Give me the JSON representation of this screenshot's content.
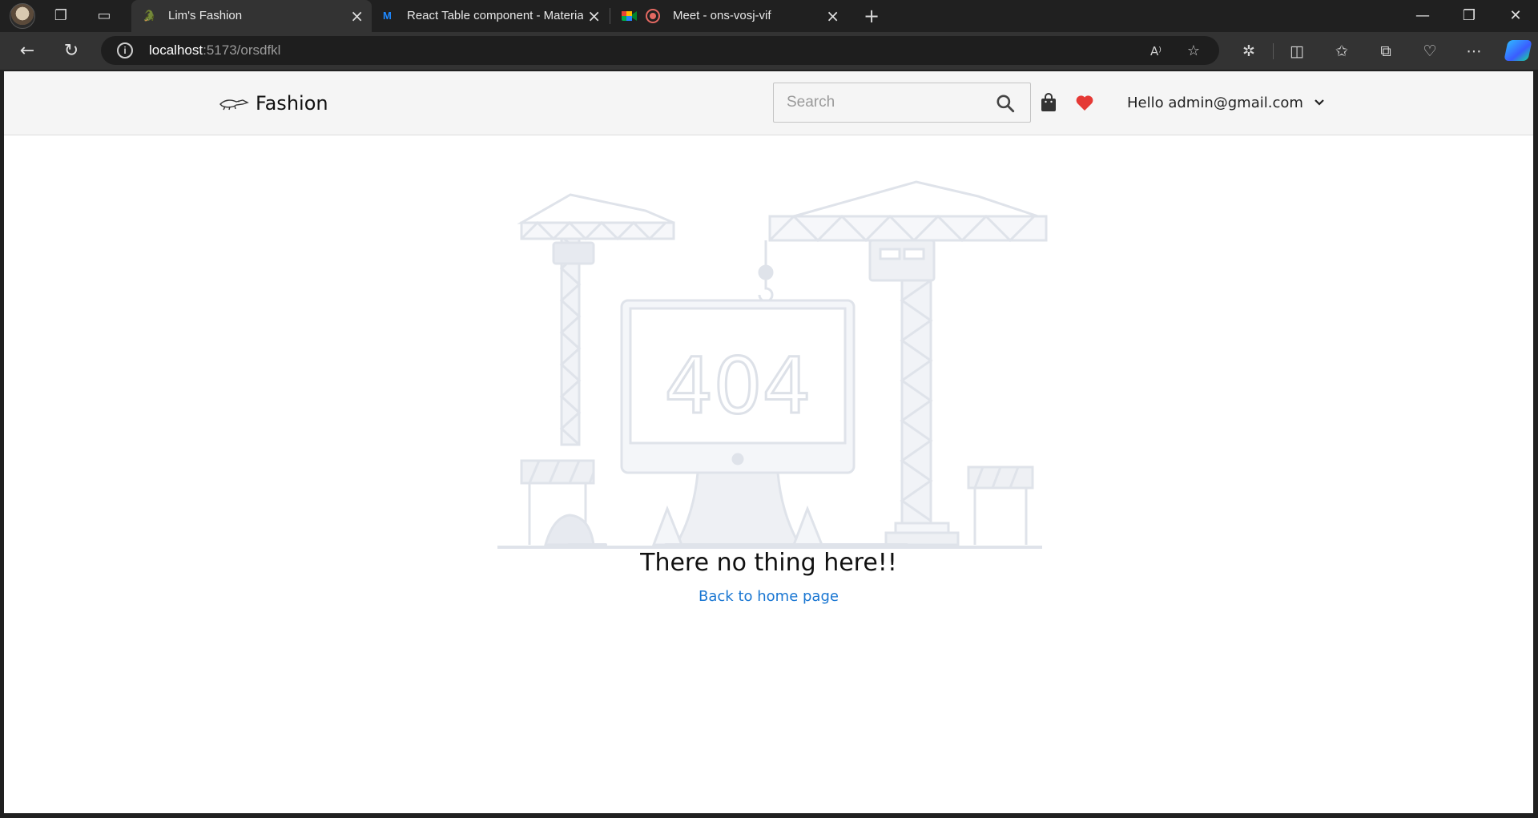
{
  "browser": {
    "tabs": [
      {
        "title": "Lim's Fashion",
        "active": true,
        "icon": "croc-favicon"
      },
      {
        "title": "React Table component - Materia",
        "active": false,
        "icon": "mui-logo-icon"
      },
      {
        "title": "Meet - ons-vosj-vif",
        "active": false,
        "icon": "meet-icon"
      }
    ],
    "address": {
      "host": "localhost",
      "path": ":5173/orsdfkl"
    },
    "toolbar_icons": [
      "read-aloud-icon",
      "favorite-star-icon",
      "extensions-icon",
      "split-screen-icon",
      "favorites-icon",
      "collections-icon",
      "browser-essentials-icon",
      "more-icon",
      "copilot-icon"
    ]
  },
  "site": {
    "brand": "Fashion",
    "search": {
      "placeholder": "Search"
    },
    "user_greeting": "Hello admin@gmail.com",
    "colors": {
      "heart": "#e53935",
      "link": "#1976d2",
      "header_bg": "#f5f5f5"
    }
  },
  "error_page": {
    "code": "404",
    "message": "There no thing here!!",
    "back_link": "Back to home page"
  }
}
